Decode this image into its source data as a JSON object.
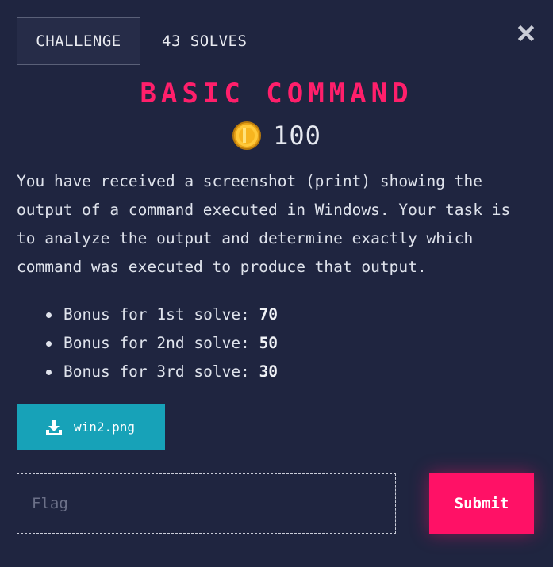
{
  "tabs": {
    "challenge_label": "CHALLENGE",
    "solves_label": "43 SOLVES"
  },
  "close_icon": "close-icon",
  "challenge": {
    "title": "BASIC COMMAND",
    "points": "100",
    "description": "You have received a screenshot (print) showing the output of a command executed in Windows. Your task is to analyze the output and determine exactly which command was executed to produce that output.",
    "bonuses": [
      {
        "label": "Bonus for 1st solve: ",
        "value": "70"
      },
      {
        "label": "Bonus for 2nd solve: ",
        "value": "50"
      },
      {
        "label": "Bonus for 3rd solve: ",
        "value": "30"
      }
    ]
  },
  "download": {
    "file_name": "win2.png",
    "icon": "download-icon"
  },
  "flag": {
    "placeholder": "Flag",
    "value": ""
  },
  "submit_label": "Submit",
  "colors": {
    "background": "#1f2540",
    "accent": "#ff1166",
    "title": "#ff1f6b",
    "download": "#17a2b8"
  }
}
